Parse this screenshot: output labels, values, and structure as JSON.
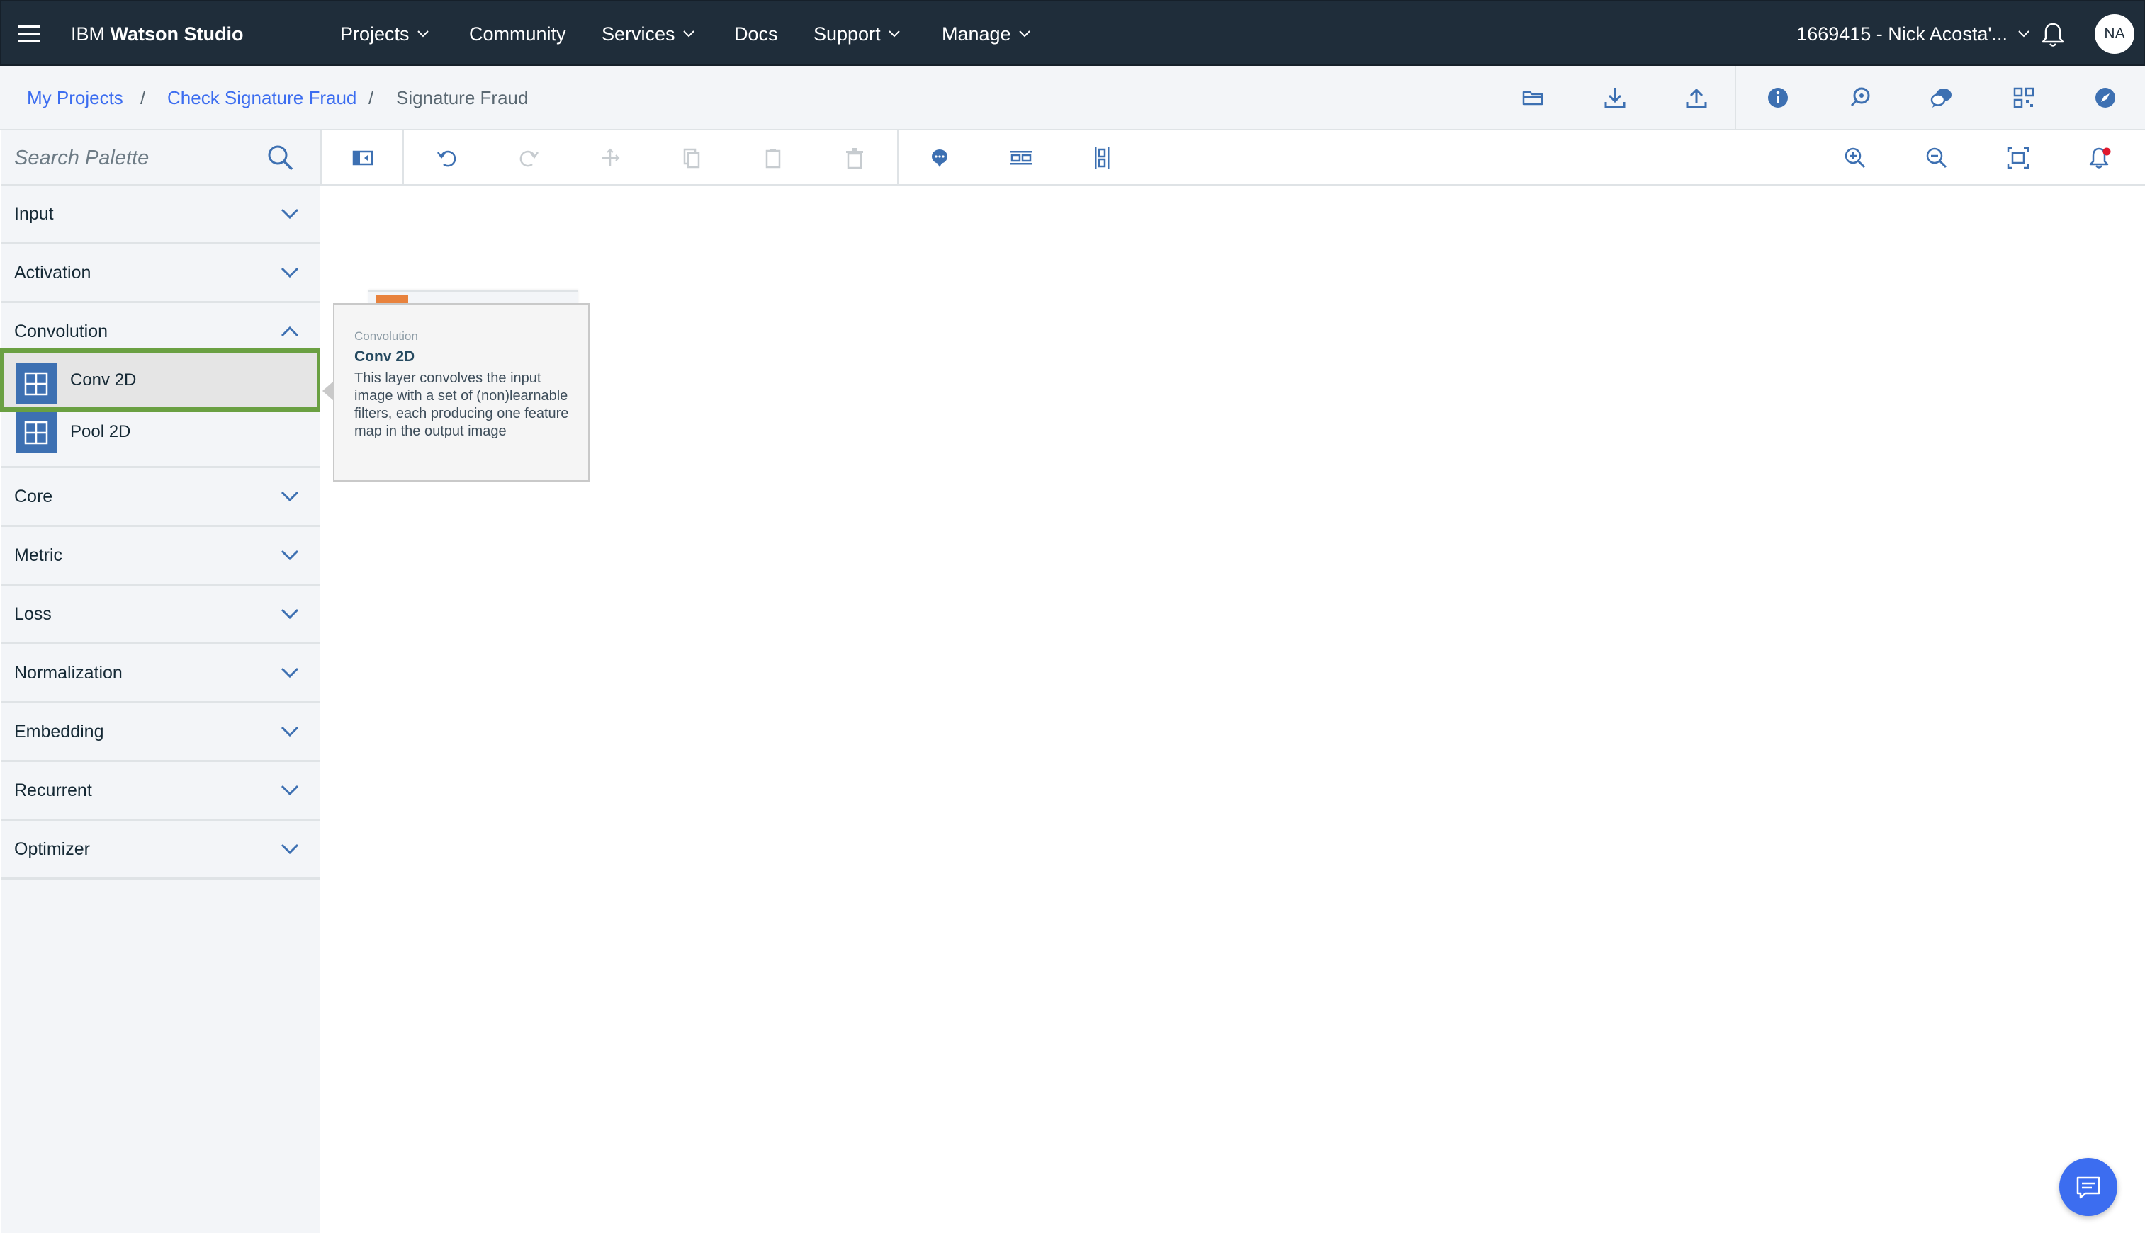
{
  "app": {
    "brand_prefix": "IBM",
    "brand_name": "Watson Studio"
  },
  "nav": {
    "items": [
      {
        "label": "Projects",
        "has_dropdown": true
      },
      {
        "label": "Community",
        "has_dropdown": false
      },
      {
        "label": "Services",
        "has_dropdown": true
      },
      {
        "label": "Docs",
        "has_dropdown": false
      },
      {
        "label": "Support",
        "has_dropdown": true
      },
      {
        "label": "Manage",
        "has_dropdown": true
      }
    ],
    "account_label": "1669415 - Nick Acosta'...",
    "avatar_initials": "NA"
  },
  "breadcrumb": {
    "items": [
      "My Projects",
      "Check Signature Fraud",
      "Signature Fraud"
    ],
    "separator": "/"
  },
  "header_actions": [
    {
      "icon": "folder-icon"
    },
    {
      "icon": "download-icon"
    },
    {
      "icon": "upload-icon"
    },
    {
      "icon": "info-icon"
    },
    {
      "icon": "deploy-icon"
    },
    {
      "icon": "chat-bubbles-icon"
    },
    {
      "icon": "grid-icon"
    },
    {
      "icon": "compass-icon"
    }
  ],
  "search": {
    "placeholder": "Search Palette",
    "value": ""
  },
  "toolbar": {
    "left_icons": [
      "toggle-palette-icon",
      "undo-icon",
      "redo-icon",
      "move-icon",
      "copy-icon",
      "paste-icon",
      "delete-icon"
    ],
    "middle_icons": [
      "comment-icon",
      "arrange-horizontal-icon",
      "arrange-vertical-icon"
    ],
    "right_icons": [
      "zoom-in-icon",
      "zoom-out-icon",
      "fit-to-screen-icon",
      "notification-icon"
    ]
  },
  "palette": {
    "categories_before": [
      {
        "label": "Input",
        "expanded": false
      },
      {
        "label": "Activation",
        "expanded": false
      },
      {
        "label": "Convolution",
        "expanded": true
      }
    ],
    "convolution_items": [
      {
        "label": "Conv 2D",
        "selected": true
      },
      {
        "label": "Pool 2D",
        "selected": false
      }
    ],
    "categories_after": [
      {
        "label": "Core",
        "expanded": false
      },
      {
        "label": "Metric",
        "expanded": false
      },
      {
        "label": "Loss",
        "expanded": false
      },
      {
        "label": "Normalization",
        "expanded": false
      },
      {
        "label": "Embedding",
        "expanded": false
      },
      {
        "label": "Recurrent",
        "expanded": false
      },
      {
        "label": "Optimizer",
        "expanded": false
      }
    ]
  },
  "tooltip": {
    "category": "Convolution",
    "title": "Conv 2D",
    "description": "This layer convolves the input image with a set of (non)learnable filters, each producing one feature map in the output image"
  },
  "colors": {
    "nav_bg": "#1f2d3a",
    "link": "#3c6df0",
    "selection_outline": "#6aa042",
    "node_icon": "#3d70b2",
    "notification_dot": "#e0182d"
  }
}
